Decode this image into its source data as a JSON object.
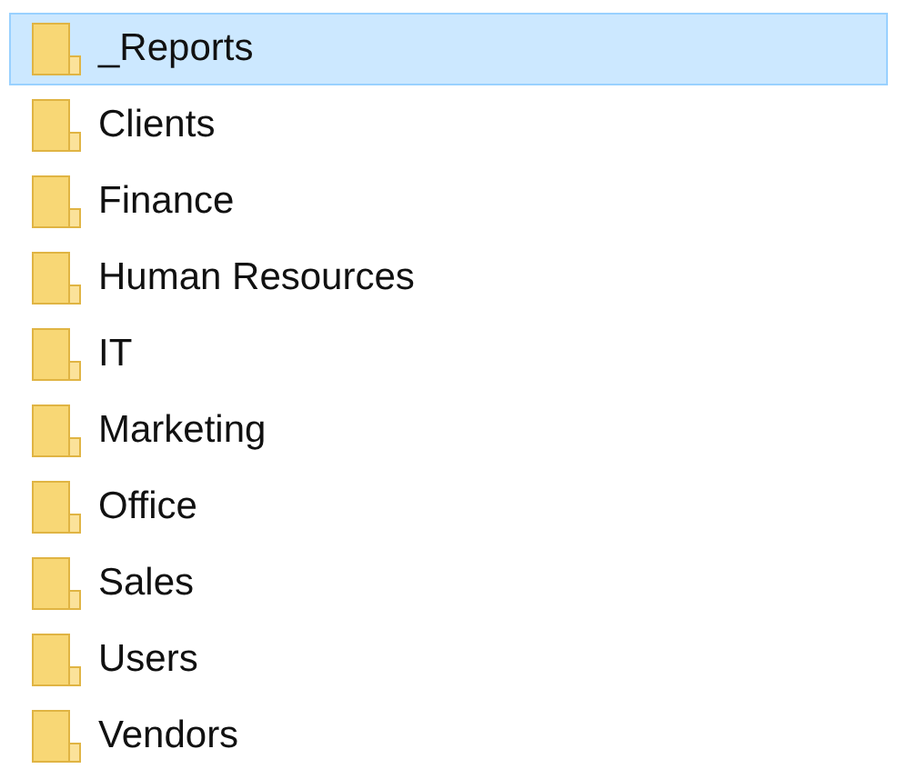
{
  "folders": [
    {
      "name": "_Reports",
      "selected": true
    },
    {
      "name": "Clients",
      "selected": false
    },
    {
      "name": "Finance",
      "selected": false
    },
    {
      "name": "Human Resources",
      "selected": false
    },
    {
      "name": "IT",
      "selected": false
    },
    {
      "name": "Marketing",
      "selected": false
    },
    {
      "name": "Office",
      "selected": false
    },
    {
      "name": "Sales",
      "selected": false
    },
    {
      "name": "Users",
      "selected": false
    },
    {
      "name": "Vendors",
      "selected": false
    }
  ]
}
